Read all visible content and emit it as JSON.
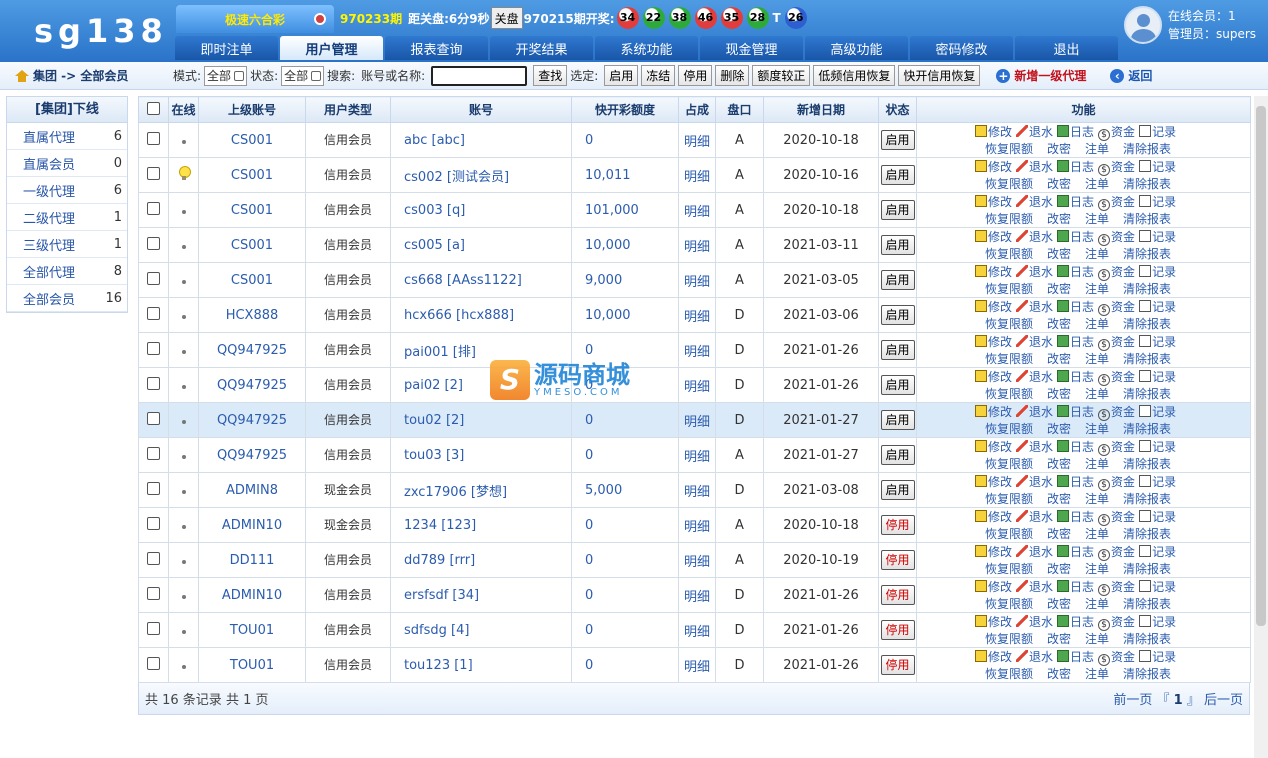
{
  "header": {
    "logo": "sg138",
    "game_name": "极速六合彩",
    "current_period": "970233期",
    "countdown_label": "距关盘:",
    "countdown_value": "6分9秒",
    "close_button": "关盘",
    "last_period": "970215期开奖:",
    "balls": [
      {
        "num": "34",
        "color": "#e23d3d"
      },
      {
        "num": "22",
        "color": "#2eaa3c"
      },
      {
        "num": "38",
        "color": "#2eaa3c"
      },
      {
        "num": "46",
        "color": "#e23d3d"
      },
      {
        "num": "35",
        "color": "#e23d3d"
      },
      {
        "num": "28",
        "color": "#2eaa3c"
      }
    ],
    "special_label": "T",
    "special_ball": {
      "num": "26",
      "color": "#2d5fd1"
    },
    "online_members": "在线会员：1",
    "admin": "管理员：supers"
  },
  "nav": [
    {
      "label": "即时注单",
      "width": 103,
      "active": false
    },
    {
      "label": "用户管理",
      "width": 103,
      "active": true
    },
    {
      "label": "报表查询",
      "width": 103,
      "active": false
    },
    {
      "label": "开奖结果",
      "width": 103,
      "active": false
    },
    {
      "label": "系统功能",
      "width": 103,
      "active": false
    },
    {
      "label": "现金管理",
      "width": 103,
      "active": false
    },
    {
      "label": "高级功能",
      "width": 103,
      "active": false
    },
    {
      "label": "密码修改",
      "width": 103,
      "active": false
    },
    {
      "label": "退出",
      "width": 103,
      "active": false
    }
  ],
  "toolbar": {
    "breadcrumb": "集团 -> 全部会员",
    "mode_label": "模式:",
    "mode_value": "全部",
    "status_label": "状态:",
    "status_value": "全部",
    "search_label": "搜索:",
    "search_hint": "账号或名称:",
    "search_button": "查找",
    "selected_label": "选定:",
    "actions": [
      "启用",
      "冻结",
      "停用",
      "删除",
      "额度较正",
      "低频信用恢复",
      "快开信用恢复"
    ],
    "add_link": "新增一级代理",
    "back_link": "返回"
  },
  "sidebar": {
    "title": "[集团]下线",
    "items": [
      {
        "label": "直属代理",
        "count": "6"
      },
      {
        "label": "直属会员",
        "count": "0"
      },
      {
        "label": "一级代理",
        "count": "6"
      },
      {
        "label": "二级代理",
        "count": "1"
      },
      {
        "label": "三级代理",
        "count": "1"
      },
      {
        "label": "全部代理",
        "count": "8"
      },
      {
        "label": "全部会员",
        "count": "16"
      }
    ]
  },
  "table": {
    "columns": [
      "",
      "在线",
      "上级账号",
      "用户类型",
      "账号",
      "快开彩额度",
      "占成",
      "盘口",
      "新增日期",
      "状态",
      "功能"
    ],
    "rows": [
      {
        "parent": "CS001",
        "type": "信用会员",
        "account": "abc [abc]",
        "quota": "0",
        "share": "明细",
        "pan": "A",
        "date": "2020-10-18",
        "status": "启用",
        "online": false
      },
      {
        "parent": "CS001",
        "type": "信用会员",
        "account": "cs002 [测试会员]",
        "quota": "10,011",
        "share": "明细",
        "pan": "A",
        "date": "2020-10-16",
        "status": "启用",
        "online": true
      },
      {
        "parent": "CS001",
        "type": "信用会员",
        "account": "cs003 [q]",
        "quota": "101,000",
        "share": "明细",
        "pan": "A",
        "date": "2020-10-18",
        "status": "启用",
        "online": false
      },
      {
        "parent": "CS001",
        "type": "信用会员",
        "account": "cs005 [a]",
        "quota": "10,000",
        "share": "明细",
        "pan": "A",
        "date": "2021-03-11",
        "status": "启用",
        "online": false
      },
      {
        "parent": "CS001",
        "type": "信用会员",
        "account": "cs668 [AAss1122]",
        "quota": "9,000",
        "share": "明细",
        "pan": "A",
        "date": "2021-03-05",
        "status": "启用",
        "online": false
      },
      {
        "parent": "HCX888",
        "type": "信用会员",
        "account": "hcx666 [hcx888]",
        "quota": "10,000",
        "share": "明细",
        "pan": "D",
        "date": "2021-03-06",
        "status": "启用",
        "online": false
      },
      {
        "parent": "QQ947925",
        "type": "信用会员",
        "account": "pai001 [排]",
        "quota": "0",
        "share": "明细",
        "pan": "D",
        "date": "2021-01-26",
        "status": "启用",
        "online": false
      },
      {
        "parent": "QQ947925",
        "type": "信用会员",
        "account": "pai02 [2]",
        "quota": "0",
        "share": "明细",
        "pan": "D",
        "date": "2021-01-26",
        "status": "启用",
        "online": false
      },
      {
        "parent": "QQ947925",
        "type": "信用会员",
        "account": "tou02 [2]",
        "quota": "0",
        "share": "明细",
        "pan": "D",
        "date": "2021-01-27",
        "status": "启用",
        "online": false,
        "highlight": true
      },
      {
        "parent": "QQ947925",
        "type": "信用会员",
        "account": "tou03 [3]",
        "quota": "0",
        "share": "明细",
        "pan": "A",
        "date": "2021-01-27",
        "status": "启用",
        "online": false
      },
      {
        "parent": "ADMIN8",
        "type": "现金会员",
        "account": "zxc17906 [梦想]",
        "quota": "5,000",
        "share": "明细",
        "pan": "D",
        "date": "2021-03-08",
        "status": "启用",
        "online": false
      },
      {
        "parent": "ADMIN10",
        "type": "现金会员",
        "account": "1234 [123]",
        "quota": "0",
        "share": "明细",
        "pan": "A",
        "date": "2020-10-18",
        "status": "停用",
        "online": false
      },
      {
        "parent": "DD111",
        "type": "信用会员",
        "account": "dd789 [rrr]",
        "quota": "0",
        "share": "明细",
        "pan": "A",
        "date": "2020-10-19",
        "status": "停用",
        "online": false
      },
      {
        "parent": "ADMIN10",
        "type": "信用会员",
        "account": "ersfsdf [34]",
        "quota": "0",
        "share": "明细",
        "pan": "D",
        "date": "2021-01-26",
        "status": "停用",
        "online": false
      },
      {
        "parent": "TOU01",
        "type": "信用会员",
        "account": "sdfsdg [4]",
        "quota": "0",
        "share": "明细",
        "pan": "D",
        "date": "2021-01-26",
        "status": "停用",
        "online": false
      },
      {
        "parent": "TOU01",
        "type": "信用会员",
        "account": "tou123 [1]",
        "quota": "0",
        "share": "明细",
        "pan": "D",
        "date": "2021-01-26",
        "status": "停用",
        "online": false
      }
    ],
    "functions_row1": [
      "修改",
      "退水",
      "日志",
      "资金",
      "记录"
    ],
    "functions_row2": [
      "恢复限额",
      "改密",
      "注单",
      "清除报表"
    ]
  },
  "footer": {
    "summary": "共 16 条记录 共 1 页",
    "prev": "前一页",
    "page_open": "『",
    "page": "1",
    "page_close": "』",
    "next": "后一页"
  },
  "watermark": {
    "mark": "S",
    "text": "源码商城",
    "sub": "YMESO.COM"
  }
}
